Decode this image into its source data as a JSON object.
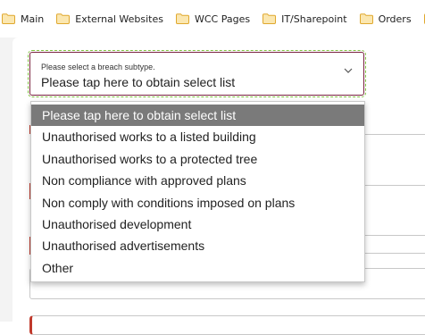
{
  "bookmarks_bar": {
    "items": [
      {
        "label": "Main",
        "icon": "folder-icon"
      },
      {
        "label": "External Websites",
        "icon": "folder-icon"
      },
      {
        "label": "WCC Pages",
        "icon": "folder-icon"
      },
      {
        "label": "IT/Sharepoint",
        "icon": "folder-icon"
      },
      {
        "label": "Orders",
        "icon": "folder-icon"
      }
    ],
    "folder_color": "#f2c14e"
  },
  "breach_subtype": {
    "label": "Please select a breach subtype.",
    "value": "Please tap here to obtain select list",
    "border_color": "#7a2240",
    "options": [
      "Please tap here to obtain select list",
      "Unauthorised works to a listed building",
      "Unauthorised works to a protected tree",
      "Non compliance with approved plans",
      "Non comply with conditions imposed on plans",
      "Unauthorised development",
      "Unauthorised advertisements",
      "Other"
    ],
    "selected_index": 0,
    "selected_bg": "#7a7a7a"
  },
  "colors": {
    "required_marker": "#c0392b",
    "focus_outline": "#7fbf3f"
  }
}
